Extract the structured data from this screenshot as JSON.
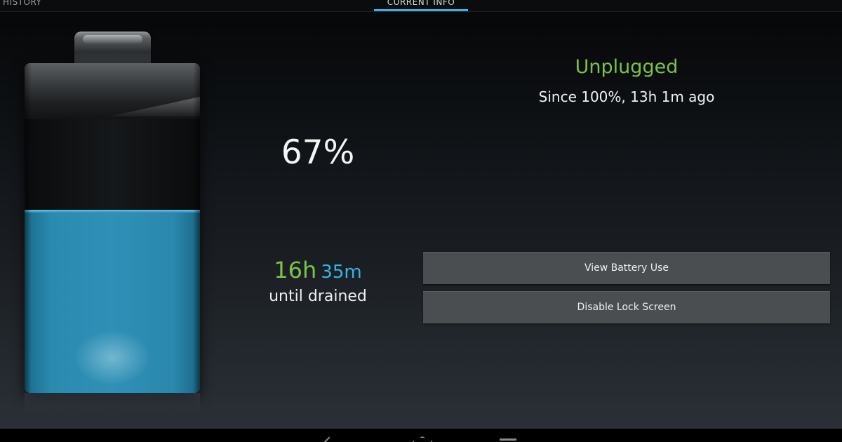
{
  "tabs": [
    {
      "label": "HISTORY"
    },
    {
      "label": "CURRENT INFO"
    }
  ],
  "active_tab_index": 1,
  "battery": {
    "level_fraction": 0.67,
    "percent_label": "67%"
  },
  "time_remaining": {
    "hours": "16h",
    "minutes": "35m",
    "caption": "until drained"
  },
  "status": {
    "state": "Unplugged",
    "since": "Since 100%, 13h 1m ago"
  },
  "buttons": {
    "view_battery_use": "View Battery Use",
    "disable_lock_screen": "Disable Lock Screen"
  },
  "navigation": {
    "icons": [
      "back-icon",
      "home-icon",
      "recents-icon"
    ]
  },
  "colors": {
    "accent_blue": "#33b5e5",
    "status_green": "#7ac34a",
    "battery_fill": "#2a8ab0",
    "button_bg": "#4b4e51"
  }
}
